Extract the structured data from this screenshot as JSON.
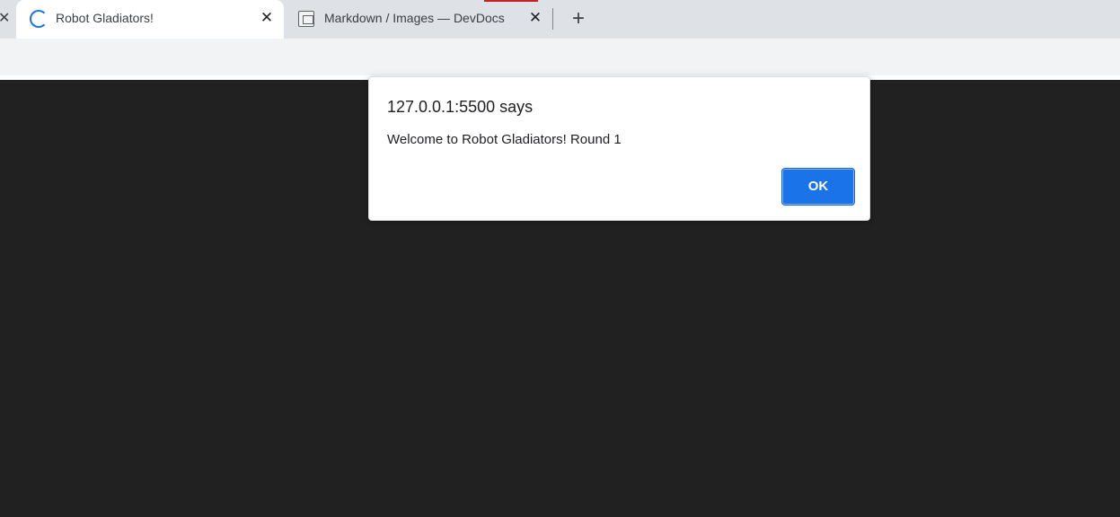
{
  "browser": {
    "tabs": [
      {
        "title": "Robot Gladiators!",
        "active": true,
        "icon": "loading-spinner-icon"
      },
      {
        "title": "Markdown / Images — DevDocs",
        "active": false,
        "icon": "devdocs-icon"
      }
    ],
    "close_glyph": "✕",
    "new_tab_glyph": "+"
  },
  "dialog": {
    "title": "127.0.0.1:5500 says",
    "message": "Welcome to Robot Gladiators! Round 1",
    "ok_label": "OK"
  },
  "colors": {
    "accent": "#1a73e8",
    "page_background": "#212121",
    "tabstrip": "#dee1e6"
  }
}
